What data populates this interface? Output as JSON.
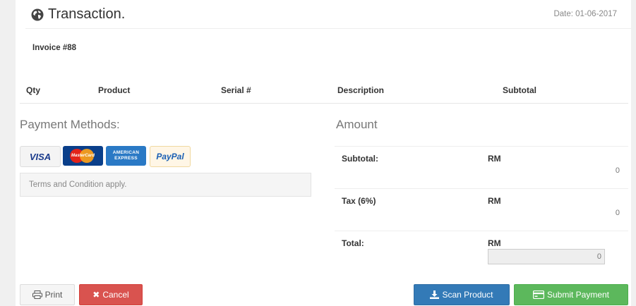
{
  "header": {
    "title": "Transaction.",
    "date": "Date: 01-06-2017"
  },
  "invoice": {
    "label": "Invoice #88"
  },
  "table": {
    "columns": [
      "Qty",
      "Product",
      "Serial #",
      "Description",
      "Subtotal"
    ]
  },
  "payment": {
    "title": "Payment Methods:",
    "cards": [
      "VISA",
      "MasterCard",
      "AMERICAN EXPRESS",
      "PayPal"
    ],
    "terms": "Terms and Condition apply."
  },
  "amount": {
    "title": "Amount",
    "rows": [
      {
        "label": "Subtotal:",
        "currency": "RM",
        "value": "0"
      },
      {
        "label": "Tax (6%)",
        "currency": "RM",
        "value": "0"
      },
      {
        "label": "Total:",
        "currency": "RM",
        "value": "0"
      }
    ]
  },
  "buttons": {
    "print": "Print",
    "cancel": "Cancel",
    "scan": "Scan Product",
    "submit": "Submit Payment"
  },
  "colors": {
    "cancel": "#d9534f",
    "scan": "#337ab7",
    "submit": "#5cb85c"
  },
  "icons": {
    "title": "globe-icon",
    "print": "print-icon",
    "cancel": "close-icon",
    "scan": "download-icon",
    "submit": "credit-card-icon"
  }
}
